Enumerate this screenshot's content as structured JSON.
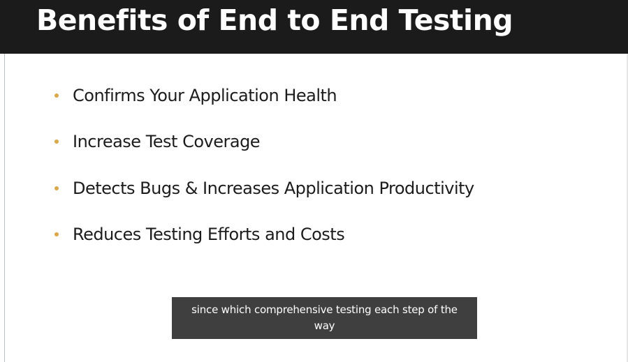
{
  "slide": {
    "title": "Benefits of End to End Testing",
    "bullets": [
      "Confirms Your Application Health",
      "Increase Test Coverage",
      "Detects Bugs & Increases Application Productivity",
      "Reduces Testing Efforts and Costs"
    ]
  },
  "caption": {
    "text": "since which comprehensive testing each step of the way"
  },
  "colors": {
    "title_bar": "#1b1b1b",
    "title_text": "#ffffff",
    "bullet_marker": "#d9a84a",
    "caption_background": "#3f3f3f",
    "caption_text": "#ffffff"
  }
}
